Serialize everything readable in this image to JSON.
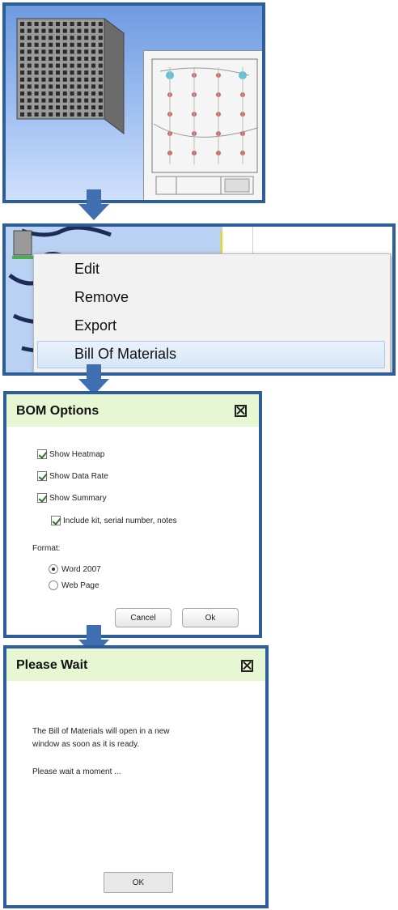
{
  "context_menu": {
    "items": [
      "Edit",
      "Remove",
      "Export",
      "Bill Of Materials"
    ]
  },
  "bom_dialog": {
    "title": "BOM Options",
    "checkboxes": [
      "Show Heatmap",
      "Show Data Rate",
      "Show Summary",
      "Include kit, serial number, notes"
    ],
    "format_label": "Format:",
    "format_options": [
      "Word 2007",
      "Web Page"
    ],
    "selected_format": "Word 2007",
    "cancel_label": "Cancel",
    "ok_label": "Ok"
  },
  "wait_dialog": {
    "title": "Please Wait",
    "message_line1": "The Bill of Materials will open in a new",
    "message_line2": "window as soon as it is ready.",
    "message_line3": "Please wait a moment ...",
    "ok_label": "OK"
  },
  "colors": {
    "panel_border": "#2e5e9a",
    "dialog_header": "#e7f7d4",
    "arrow": "#3f6fb0"
  }
}
